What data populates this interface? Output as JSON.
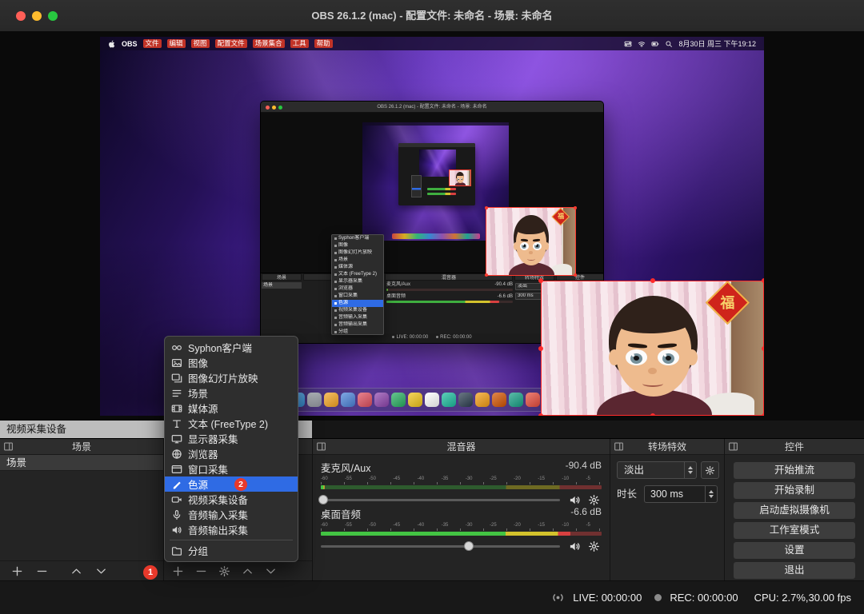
{
  "colors": {
    "accent": "#2f6be4",
    "badge": "#e8392b",
    "selection": "#ff2b2b"
  },
  "window": {
    "title": "OBS 26.1.2 (mac) - 配置文件: 未命名 - 场景: 未命名"
  },
  "captured_screen": {
    "menubar": {
      "items": [
        "OBS",
        "文件",
        "编辑",
        "视图",
        "配置文件",
        "场景集合",
        "工具",
        "帮助"
      ],
      "clock": "8月30日 周三 下午19:12"
    },
    "dock_apps": [
      "#3aa0f0",
      "#9aa0a8",
      "#f5a623",
      "#4a82d9",
      "#e04f5f",
      "#8e44ad",
      "#27ae60",
      "#f0c419",
      "#ffffff",
      "#1abc9c",
      "#2c3e50",
      "#f39c12",
      "#d35400",
      "#16a085",
      "#e74c3c",
      "#3b5998",
      "#8a8f98"
    ]
  },
  "nested_window": {
    "title": "OBS 26.1.2 (mac) - 配置文件: 未命名 - 场景: 未命名"
  },
  "add_source_menu": {
    "items": [
      {
        "label": "Syphon客户端",
        "icon": "syphon"
      },
      {
        "label": "图像",
        "icon": "image"
      },
      {
        "label": "图像幻灯片放映",
        "icon": "slideshow"
      },
      {
        "label": "场景",
        "icon": "scene"
      },
      {
        "label": "媒体源",
        "icon": "media"
      },
      {
        "label": "文本 (FreeType 2)",
        "icon": "text"
      },
      {
        "label": "显示器采集",
        "icon": "display"
      },
      {
        "label": "浏览器",
        "icon": "browser"
      },
      {
        "label": "窗口采集",
        "icon": "window"
      },
      {
        "label": "色源",
        "icon": "color",
        "selected": true,
        "badge": "2"
      },
      {
        "label": "视频采集设备",
        "icon": "camera"
      },
      {
        "label": "音频输入采集",
        "icon": "mic"
      },
      {
        "label": "音频输出采集",
        "icon": "speaker"
      },
      {
        "label": "分组",
        "icon": "folder",
        "sep": true
      }
    ]
  },
  "floating_label": "视频采集设备",
  "webcam": {
    "decoration": "福"
  },
  "docks": {
    "scenes": {
      "title": "场景",
      "rows": [
        "场景"
      ]
    },
    "mixer": {
      "title": "混音器",
      "scale": [
        "-60",
        "-55",
        "-50",
        "-45",
        "-40",
        "-35",
        "-30",
        "-25",
        "-20",
        "-15",
        "-10",
        "-5"
      ],
      "channels": [
        {
          "name": "麦克风/Aux",
          "db": "-90.4 dB",
          "meter": 0.015,
          "slider": 0.01
        },
        {
          "name": "桌面音频",
          "db": "-6.6 dB",
          "meter": 0.89,
          "slider": 0.62
        }
      ]
    },
    "transitions": {
      "title": "转场特效",
      "selected": "淡出",
      "duration_label": "时长",
      "duration": "300 ms"
    },
    "controls": {
      "title": "控件",
      "buttons": [
        "开始推流",
        "开始录制",
        "启动虚拟摄像机",
        "工作室模式",
        "设置",
        "退出"
      ]
    }
  },
  "badges": {
    "step1": "1"
  },
  "statusbar": {
    "live": "LIVE: 00:00:00",
    "rec": "REC: 00:00:00",
    "cpu": "CPU: 2.7%,30.00 fps"
  }
}
